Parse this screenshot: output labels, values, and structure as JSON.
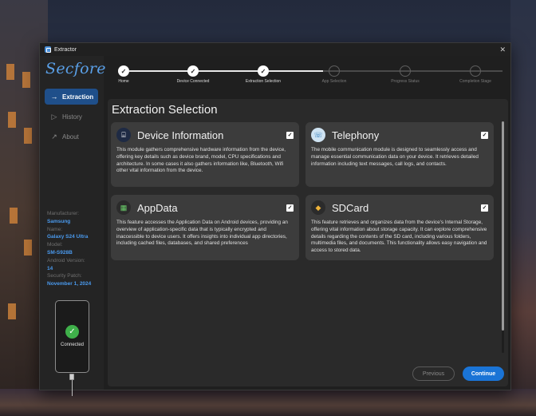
{
  "window": {
    "title": "Extractor",
    "close_icon": "close-icon"
  },
  "sidebar": {
    "logo": "Secfore",
    "items": [
      {
        "label": "Extraction",
        "icon": "→",
        "active": true
      },
      {
        "label": "History",
        "icon": "▷",
        "active": false
      },
      {
        "label": "About",
        "icon": "↗",
        "active": false
      }
    ],
    "device": {
      "manufacturer_label": "Manufacturer:",
      "manufacturer": "Samsung",
      "name_label": "Name:",
      "name": "Galaxy S24 Ultra",
      "model_label": "Model:",
      "model": "SM-S928B",
      "android_label": "Android Version:",
      "android": "14",
      "patch_label": "Security Patch:",
      "patch": "November 1, 2024"
    },
    "connection_status": "Connected"
  },
  "stepper": {
    "steps": [
      {
        "label": "Home",
        "done": true
      },
      {
        "label": "Device Connected",
        "done": true
      },
      {
        "label": "Extraction Selection",
        "done": true
      },
      {
        "label": "App Selection",
        "done": false
      },
      {
        "label": "Progress Status",
        "done": false
      },
      {
        "label": "Completion Stage",
        "done": false
      }
    ]
  },
  "main": {
    "title": "Extraction Selection",
    "cards": [
      {
        "title": "Device Information",
        "checked": true,
        "icon": "device-info-icon",
        "description": "This module gathers comprehensive hardware information from the device, offering key details such as device brand, model, CPU specifications and architecture. In some cases it also gathers information like, Bluetooth, Wifi  other vital information from the device."
      },
      {
        "title": "Telephony",
        "checked": true,
        "icon": "telephony-icon",
        "description": "The mobile communication module is designed to seamlessly access and manage essential communication data on your device. It retrieves detailed information including text messages, call logs, and contacts."
      },
      {
        "title": "AppData",
        "checked": true,
        "icon": "appdata-icon",
        "description": "This feature accesses the Application Data on Android devices, providing an overview of application-specific data that is typically encrypted and inaccessible to device users. It offers insights into individual app directories, including cached files, databases, and shared preferences"
      },
      {
        "title": "SDCard",
        "checked": true,
        "icon": "sdcard-icon",
        "description": "This feature retrieves and organizes data from the device's Internal Storage, offering vital information about storage capacity. It can explore comprehensive details regarding the contents of the SD card, including various folders, multimedia files, and documents. This functionality allows easy navigation and access to stored data."
      }
    ],
    "buttons": {
      "previous": "Previous",
      "continue": "Continue"
    }
  },
  "colors": {
    "accent": "#1a74d6",
    "active_nav": "#1f4f8a",
    "device_value": "#4a9aee",
    "success": "#3fb04a"
  }
}
